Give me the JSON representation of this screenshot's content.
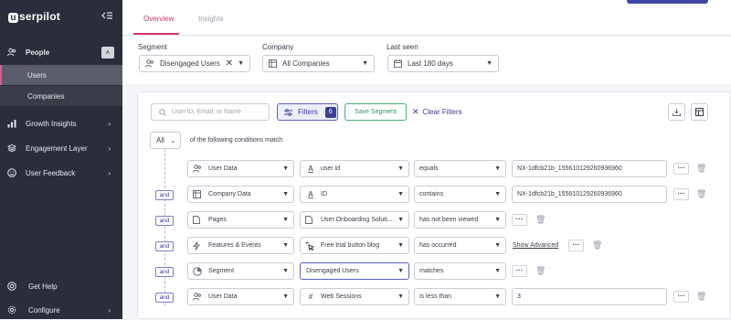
{
  "sidebar": {
    "logo": "serpilot",
    "logo_mark": "u",
    "items": [
      {
        "label": "People",
        "icon": "people-icon"
      },
      {
        "label": "Growth Insights",
        "icon": "growth-insights-icon"
      },
      {
        "label": "Engagement Layer",
        "icon": "engagement-layer-icon"
      },
      {
        "label": "User Feedback",
        "icon": "user-feedback-icon"
      }
    ],
    "people_sub": [
      {
        "label": "Users"
      },
      {
        "label": "Companies"
      }
    ],
    "bottom": [
      {
        "label": "Get Help",
        "icon": "help-icon"
      },
      {
        "label": "Configure",
        "icon": "gear-icon"
      }
    ]
  },
  "tabs": [
    {
      "label": "Overview"
    },
    {
      "label": "Insights"
    }
  ],
  "filterbar": {
    "segment_label": "Segment",
    "segment_value": "Disengaged Users",
    "company_label": "Company",
    "company_value": "All Companies",
    "last_seen_label": "Last seen",
    "last_seen_value": "Last 180 days"
  },
  "toolbar": {
    "search_placeholder": "User ID, Email, or Name",
    "filters_label": "Filters",
    "filters_count": "6",
    "save_segment": "Save Segment",
    "clear_filters": "Clear Filters"
  },
  "match": {
    "all": "All",
    "text": "of the following conditions match"
  },
  "conditions": [
    {
      "connector": "",
      "source": "User Data",
      "field": "user id",
      "field_icon": "A",
      "op": "equals",
      "value": "NX-1dfcb21b_155610129260936960",
      "extra": ""
    },
    {
      "connector": "and",
      "source": "Company Data",
      "field": "ID",
      "field_icon": "A",
      "op": "contains",
      "value": "NX-1dfcb21b_155610129260936960",
      "extra": ""
    },
    {
      "connector": "and",
      "source": "Pages",
      "field": "User Onboarding Soluti...",
      "field_icon": "page",
      "op": "has not been viewed",
      "value": "",
      "extra": ""
    },
    {
      "connector": "and",
      "source": "Features & Events",
      "field": "Free trial button blog",
      "field_icon": "event",
      "op": "has occurred",
      "value": "",
      "extra": "Show Advanced"
    },
    {
      "connector": "and",
      "source": "Segment",
      "field": "Disengaged Users",
      "field_icon": "",
      "op": "matches",
      "value": "",
      "extra": ""
    },
    {
      "connector": "and",
      "source": "User Data",
      "field": "Web Sessions",
      "field_icon": "#",
      "op": "is less than",
      "value": "3",
      "extra": ""
    }
  ],
  "colors": {
    "sidebar_bg": "#2b2d3a",
    "accent_pink": "#d6336c",
    "accent_indigo": "#3b3f99",
    "save_green": "#2e9a5f"
  }
}
